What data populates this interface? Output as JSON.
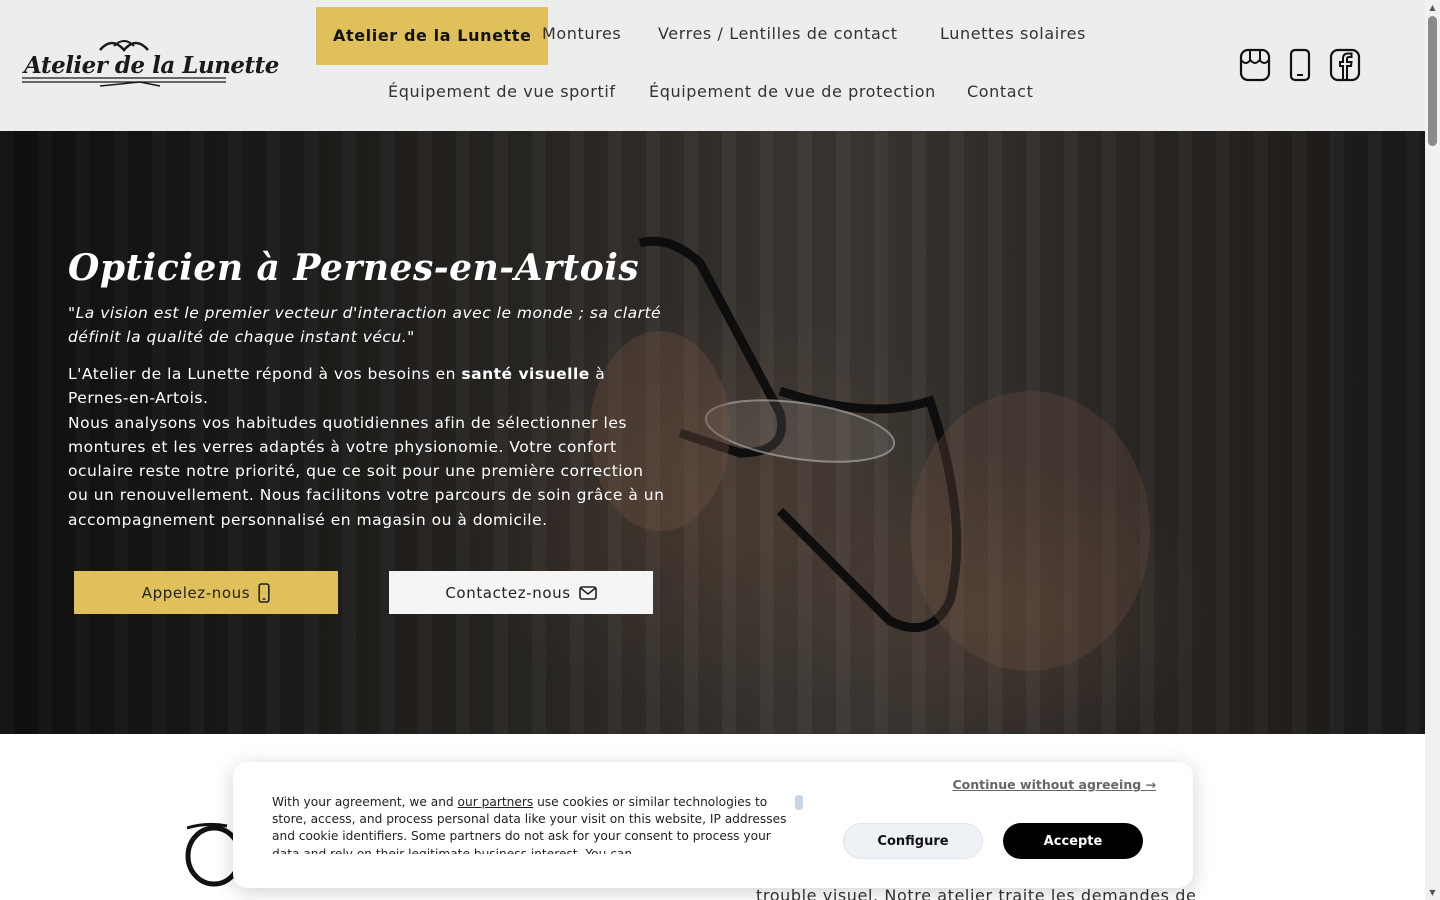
{
  "header": {
    "logo_text": "Atelier de la Lunette",
    "nav": [
      {
        "label": "Atelier de la Lunette",
        "active": true
      },
      {
        "label": "Montures"
      },
      {
        "label": "Verres / Lentilles de contact"
      },
      {
        "label": "Lunettes solaires"
      },
      {
        "label": "Équipement de vue sportif"
      },
      {
        "label": "Équipement de vue de protection"
      },
      {
        "label": "Contact"
      }
    ],
    "social_icons": [
      "storefront-icon",
      "mobile-phone-icon",
      "facebook-icon"
    ]
  },
  "hero": {
    "title": "Opticien à Pernes-en-Artois",
    "quote": "\"La vision est le premier vecteur d'interaction avec le monde ; sa clarté définit la qualité de chaque instant vécu.\"",
    "text_before_bold": "L'Atelier de la Lunette répond à vos besoins en ",
    "text_bold": "santé visuelle",
    "text_after_bold": " à Pernes-en-Artois.",
    "paragraph": "Nous analysons vos habitudes quotidiennes afin de sélectionner les montures et les verres adaptés à votre physionomie. Votre confort oculaire reste notre priorité, que ce soit pour une première correction ou un renouvellement. Nous facilitons votre parcours de soin grâce à un accompagnement personnalisé en magasin ou à domicile.",
    "call_button": "Appelez-nous",
    "contact_button": "Contactez-nous"
  },
  "below": {
    "partial_text": "trouble visuel. Notre atelier traite les demandes de"
  },
  "cookie": {
    "text_start": "With your agreement, we and ",
    "partners_link": "our partners",
    "text_rest": " use cookies or similar technologies to store, access, and process personal data like your visit on this website, IP addresses and cookie identifiers. Some partners do not ask for your consent to process your data and rely on their legitimate business interest. You can",
    "continue_link": "Continue without agreeing →",
    "configure_button": "Configure",
    "accept_button": "Accepte"
  },
  "colors": {
    "accent": "#dfc05b",
    "header_bg": "#ededed",
    "dark": "#1a1a1a"
  }
}
